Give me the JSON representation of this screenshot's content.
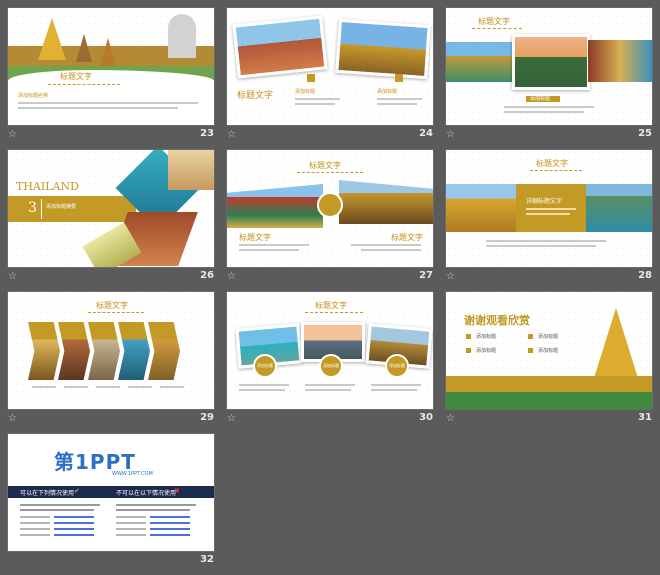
{
  "slides": [
    {
      "number": "23",
      "title": "标题文字",
      "subtitle": "添加标题名称"
    },
    {
      "number": "24",
      "title": "标题文字",
      "items": [
        "添加标题",
        "添加标题"
      ]
    },
    {
      "number": "25",
      "title": "标题文字",
      "caption": "添加标题"
    },
    {
      "number": "26",
      "heading": "THAILAND",
      "index": "3",
      "caption": "添加标题摘要"
    },
    {
      "number": "27",
      "title": "标题文字",
      "left": "标题文字",
      "right": "标题文字"
    },
    {
      "number": "28",
      "title": "标题文字",
      "box": "详细标题文字"
    },
    {
      "number": "29",
      "title": "标题文字"
    },
    {
      "number": "30",
      "title": "标题文字",
      "badges": [
        "添加标题",
        "添加标题",
        "添加标题"
      ]
    },
    {
      "number": "31",
      "title": "谢谢观看欣赏",
      "items": [
        "添加标题",
        "添加标题",
        "添加标题",
        "添加标题"
      ]
    },
    {
      "number": "32",
      "logo": "第1PPT",
      "logo_sub": "WWW.1PPT.COM",
      "left_head": "可以在下列情况使用",
      "right_head": "不可以在以下情况使用"
    }
  ],
  "colors": {
    "bg": "#5b5b5b",
    "gold": "#c39a25",
    "navy": "#1c2a4f"
  }
}
